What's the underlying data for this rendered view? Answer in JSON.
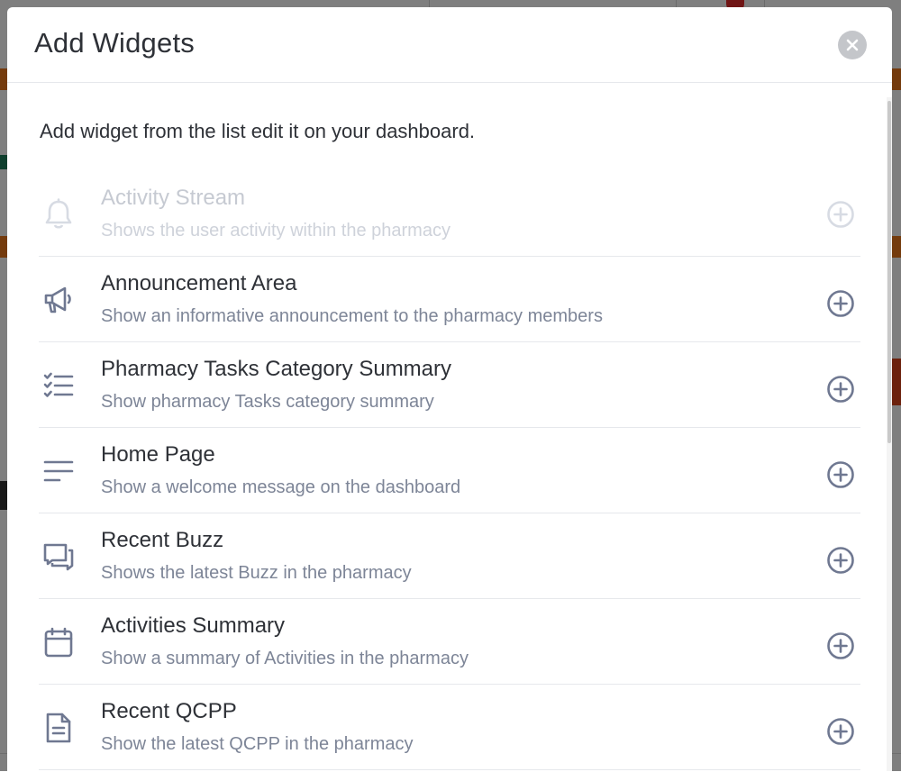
{
  "modal": {
    "title": "Add Widgets",
    "intro": "Add widget from the list edit it on your dashboard."
  },
  "widgets": [
    {
      "icon": "bell-icon",
      "title": "Activity Stream",
      "description": "Shows the user activity within the pharmacy",
      "disabled": true
    },
    {
      "icon": "megaphone-icon",
      "title": "Announcement Area",
      "description": "Show an informative announcement to the pharmacy members",
      "disabled": false
    },
    {
      "icon": "checklist-icon",
      "title": "Pharmacy Tasks Category Summary",
      "description": "Show pharmacy Tasks category summary",
      "disabled": false
    },
    {
      "icon": "text-lines-icon",
      "title": "Home Page",
      "description": "Show a welcome message on the dashboard",
      "disabled": false
    },
    {
      "icon": "chat-icon",
      "title": "Recent Buzz",
      "description": "Shows the latest Buzz in the pharmacy",
      "disabled": false
    },
    {
      "icon": "calendar-icon",
      "title": "Activities Summary",
      "description": "Show a summary of Activities in the pharmacy",
      "disabled": false
    },
    {
      "icon": "document-icon",
      "title": "Recent QCPP",
      "description": "Show the latest QCPP in the pharmacy",
      "disabled": false
    }
  ],
  "colors": {
    "text_primary": "#2e3137",
    "text_secondary": "#7d8597",
    "icon": "#6f7891",
    "disabled": "#d7dbe3",
    "background_accent": "#e8761a"
  }
}
